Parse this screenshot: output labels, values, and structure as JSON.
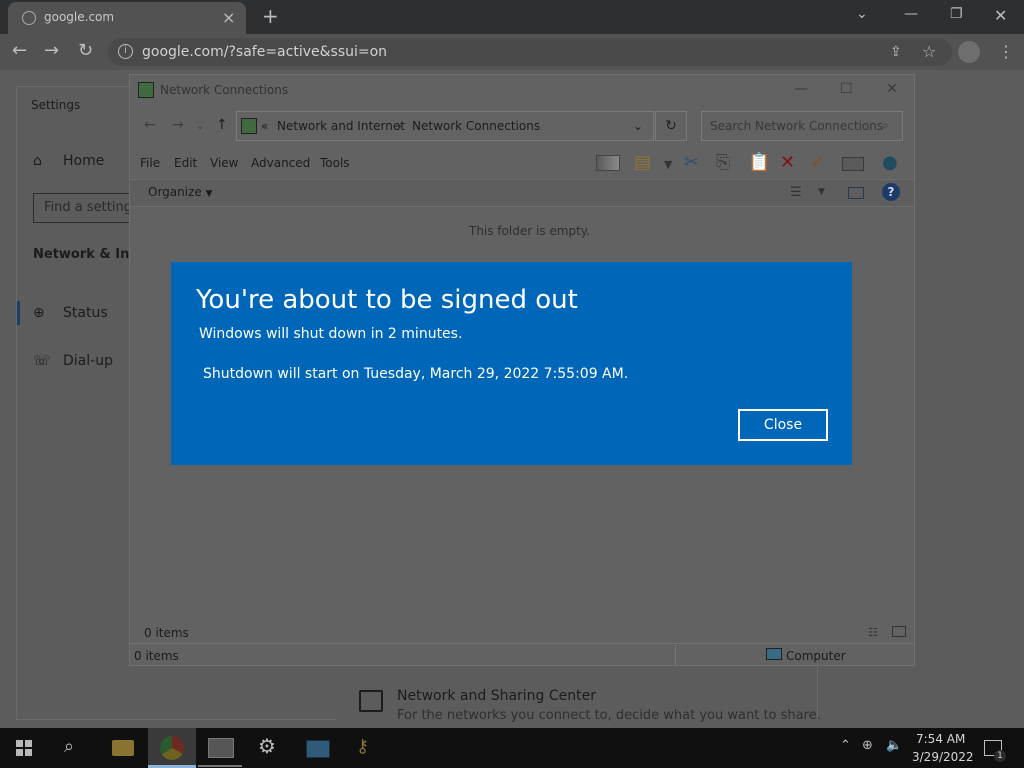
{
  "browser": {
    "tab_title": "google.com",
    "url": "google.com/?safe=active&ssui=on",
    "new_tab_label": "+"
  },
  "settings": {
    "window_title": "Settings",
    "home_label": "Home",
    "search_placeholder": "Find a setting",
    "section_label": "Network & Inte",
    "nav_items": [
      {
        "label": "Status",
        "icon": "globe-icon"
      },
      {
        "label": "Dial-up",
        "icon": "phone-icon"
      }
    ],
    "sharing_center": {
      "title": "Network and Sharing Center",
      "description": "For the networks you connect to, decide what you want to share."
    }
  },
  "explorer": {
    "window_title": "Network Connections",
    "breadcrumb": [
      "Network and Internet",
      "Network Connections"
    ],
    "search_placeholder": "Search Network Connections",
    "menu": [
      "File",
      "Edit",
      "View",
      "Advanced",
      "Tools"
    ],
    "organize_label": "Organize",
    "empty_message": "This folder is empty.",
    "items_count": "0 items",
    "status_items": "0 items",
    "status_location": "Computer"
  },
  "dialog": {
    "title": "You're about to be signed out",
    "line1": "Windows will shut down in 2 minutes.",
    "line2": "Shutdown will start on Tuesday, March 29, 2022 7:55:09 AM.",
    "close_label": "Close",
    "accent_color": "#0067b8"
  },
  "taskbar": {
    "time": "7:54 AM",
    "date": "3/29/2022",
    "notification_count": "1"
  }
}
